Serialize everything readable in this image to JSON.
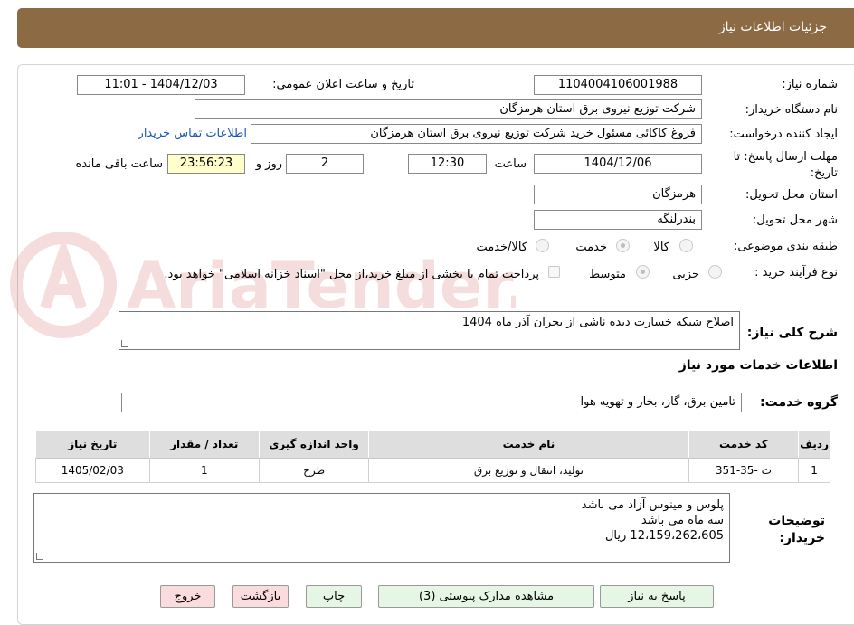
{
  "header": {
    "title": "جزئیات اطلاعات نیاز"
  },
  "fields": {
    "need_number_label": "شماره نیاز:",
    "need_number": "1104004106001988",
    "announce_label": "تاریخ و ساعت اعلان عمومی:",
    "announce_value": "1404/12/03 - 11:01",
    "buyer_org_label": "نام دستگاه خریدار:",
    "buyer_org": "شرکت توزیع نیروی برق استان هرمزگان",
    "requester_label": "ایجاد کننده درخواست:",
    "requester": "فروغ کاکائی مسئول خرید شرکت توزیع نیروی برق استان هرمزگان",
    "contact_link": "اطلاعات تماس خریدار",
    "deadline_label_1": "مهلت ارسال پاسخ: تا",
    "deadline_label_2": "تاریخ:",
    "deadline_date": "1404/12/06",
    "time_label": "ساعت",
    "deadline_time": "12:30",
    "days_value": "2",
    "days_label": "روز و",
    "remaining_time": "23:56:23",
    "remaining_label": "ساعت باقی مانده",
    "province_label": "استان محل تحویل:",
    "province": "هرمزگان",
    "city_label": "شهر محل تحویل:",
    "city": "بندرلنگه",
    "category_label": "طبقه بندی موضوعی:",
    "category_options": [
      "کالا",
      "خدمت",
      "کالا/خدمت"
    ],
    "category_selected": "خدمت",
    "process_label": "نوع فرآیند خرید :",
    "process_options": [
      "جزیی",
      "متوسط"
    ],
    "process_selected": "متوسط",
    "payment_note": "پرداخت تمام یا بخشی از مبلغ خرید،از محل \"اسناد خزانه اسلامی\" خواهد بود.",
    "summary_label": "شرح کلی نیاز:",
    "summary": "اصلاح شبکه خسارت دیده ناشی از بحران آذر ماه 1404",
    "services_heading": "اطلاعات خدمات مورد نیاز",
    "service_group_label": "گروه خدمت:",
    "service_group": "تامین برق، گاز، بخار و تهویه هوا"
  },
  "table": {
    "headers": [
      "ردیف",
      "کد خدمت",
      "نام خدمت",
      "واحد اندازه گیری",
      "تعداد / مقدار",
      "تاریخ نیاز"
    ],
    "rows": [
      [
        "1",
        "ت -35-351",
        "تولید، انتقال و توزیع برق",
        "طرح",
        "1",
        "1405/02/03"
      ]
    ]
  },
  "notes": {
    "label_1": "توضیحات",
    "label_2": "خریدار:",
    "line_1": "پلوس و مینوس آزاد می باشد",
    "line_2": "سه ماه می باشد",
    "line_3": "12،159،262،605 ریال"
  },
  "buttons": {
    "reply": "پاسخ به نیاز",
    "attachments": "مشاهده مدارک پیوستی (3)",
    "print": "چاپ",
    "back": "بازگشت",
    "exit": "خروج"
  },
  "watermark_text": "AriaTender.neT",
  "colors": {
    "header": "#8b6a44",
    "link": "#1a57b8",
    "remaining_bg": "#ffffcc"
  }
}
